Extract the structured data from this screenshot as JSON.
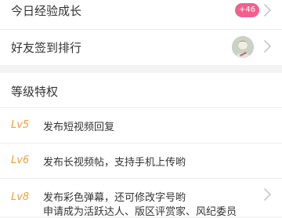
{
  "daily_growth": {
    "label": "今日经验成长",
    "badge": "+46",
    "badge_color": "#f25f8e",
    "chevron_icon": "chevron-right-icon"
  },
  "friends_rank": {
    "label": "好友签到排行",
    "avatar_icon": "user-avatar",
    "chevron_icon": "chevron-right-icon"
  },
  "privileges": {
    "title": "等级特权",
    "level_color": "#f0a23c",
    "items": [
      {
        "level": "Lv5",
        "lines": [
          "发布短视频回复"
        ]
      },
      {
        "level": "Lv6",
        "lines": [
          "发布长视频帖，支持手机上传哟"
        ]
      },
      {
        "level": "Lv8",
        "lines": [
          "发布彩色弹幕，还可修改字号哟",
          "申请成为活跃达人、版区评赏家、风纪委员"
        ]
      }
    ]
  }
}
